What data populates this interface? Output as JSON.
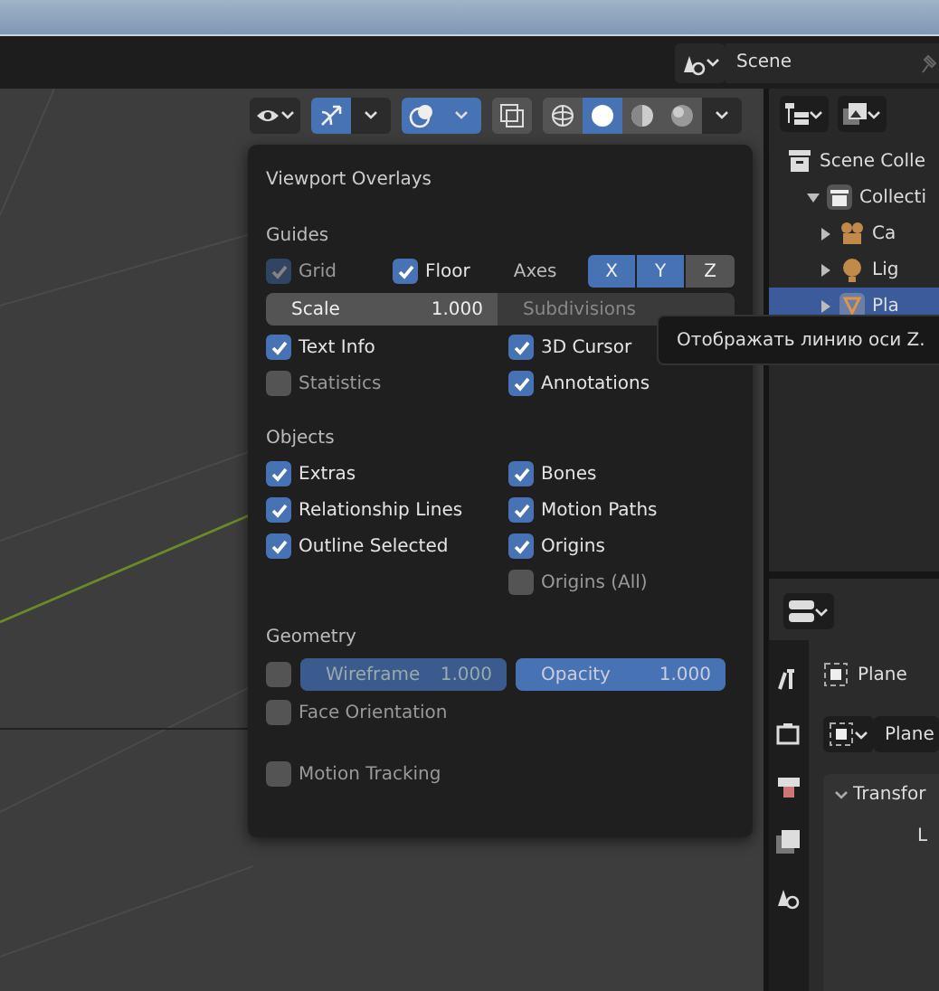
{
  "header": {
    "scene": "Scene"
  },
  "viewport_header": {
    "gizmos_on": true,
    "overlays_on": true,
    "xray_on": false,
    "shading": [
      {
        "kind": "wireframe",
        "selected": false
      },
      {
        "kind": "solid",
        "selected": true
      },
      {
        "kind": "material",
        "selected": false
      },
      {
        "kind": "rendered",
        "selected": false
      }
    ]
  },
  "overlays": {
    "title": "Viewport Overlays",
    "sections": [
      {
        "title": "Guides",
        "rows": [
          {
            "kind": "guides"
          },
          {
            "kind": "pair",
            "left": {
              "label": "Text Info",
              "checked": true
            },
            "right": {
              "label": "3D Cursor",
              "checked": true
            }
          },
          {
            "kind": "pair",
            "left": {
              "label": "Statistics",
              "checked": false
            },
            "right": {
              "label": "Annotations",
              "checked": true
            }
          }
        ]
      },
      {
        "title": "Objects",
        "rows": [
          {
            "kind": "pair",
            "left": {
              "label": "Extras",
              "checked": true
            },
            "right": {
              "label": "Bones",
              "checked": true
            }
          },
          {
            "kind": "pair",
            "left": {
              "label": "Relationship Lines",
              "checked": true
            },
            "right": {
              "label": "Motion Paths",
              "checked": true
            }
          },
          {
            "kind": "pair",
            "left": {
              "label": "Outline Selected",
              "checked": true
            },
            "right": {
              "label": "Origins",
              "checked": true
            }
          },
          {
            "kind": "pair",
            "right": {
              "label": "Origins (All)",
              "checked": false
            }
          }
        ]
      },
      {
        "title": "Geometry",
        "rows": [
          {
            "kind": "wireframe",
            "checked": false,
            "wireframe": {
              "label": "Wireframe",
              "value": "1.000",
              "level": 1,
              "disabled": true
            },
            "opacity": {
              "label": "Opacity",
              "value": "1.000",
              "level": 1,
              "disabled": false
            }
          },
          {
            "kind": "single",
            "item": {
              "label": "Face Orientation",
              "checked": false
            }
          },
          {
            "kind": "gap"
          },
          {
            "kind": "single",
            "item": {
              "label": "Motion Tracking",
              "checked": false
            }
          }
        ]
      }
    ],
    "guides": {
      "grid": {
        "label": "Grid",
        "checked": true,
        "disabled": true
      },
      "floor": {
        "label": "Floor",
        "checked": true
      },
      "axes_label": "Axes",
      "axes": [
        {
          "label": "X",
          "selected": true
        },
        {
          "label": "Y",
          "selected": true
        },
        {
          "label": "Z",
          "selected": false
        }
      ],
      "scale": {
        "label": "Scale",
        "value": "1.000",
        "disabled": false
      },
      "subdivisions": {
        "label": "Subdivisions",
        "disabled": true
      }
    }
  },
  "tooltip": "Отображать линию оси Z.",
  "outliner": {
    "items": [
      {
        "label": "Scene Colle",
        "kind": "scene",
        "selected": false,
        "children": [
          {
            "label": "Collecti",
            "kind": "collection",
            "selected": false,
            "children": [
              {
                "label": "Ca",
                "kind": "camera",
                "selected": false
              },
              {
                "label": "Lig",
                "kind": "light",
                "selected": false
              },
              {
                "label": "Pla",
                "kind": "mesh",
                "selected": true
              }
            ]
          }
        ]
      }
    ]
  },
  "properties": {
    "object": "Plane",
    "data": "Plane",
    "panel": "Transfor",
    "field_label": "L"
  }
}
